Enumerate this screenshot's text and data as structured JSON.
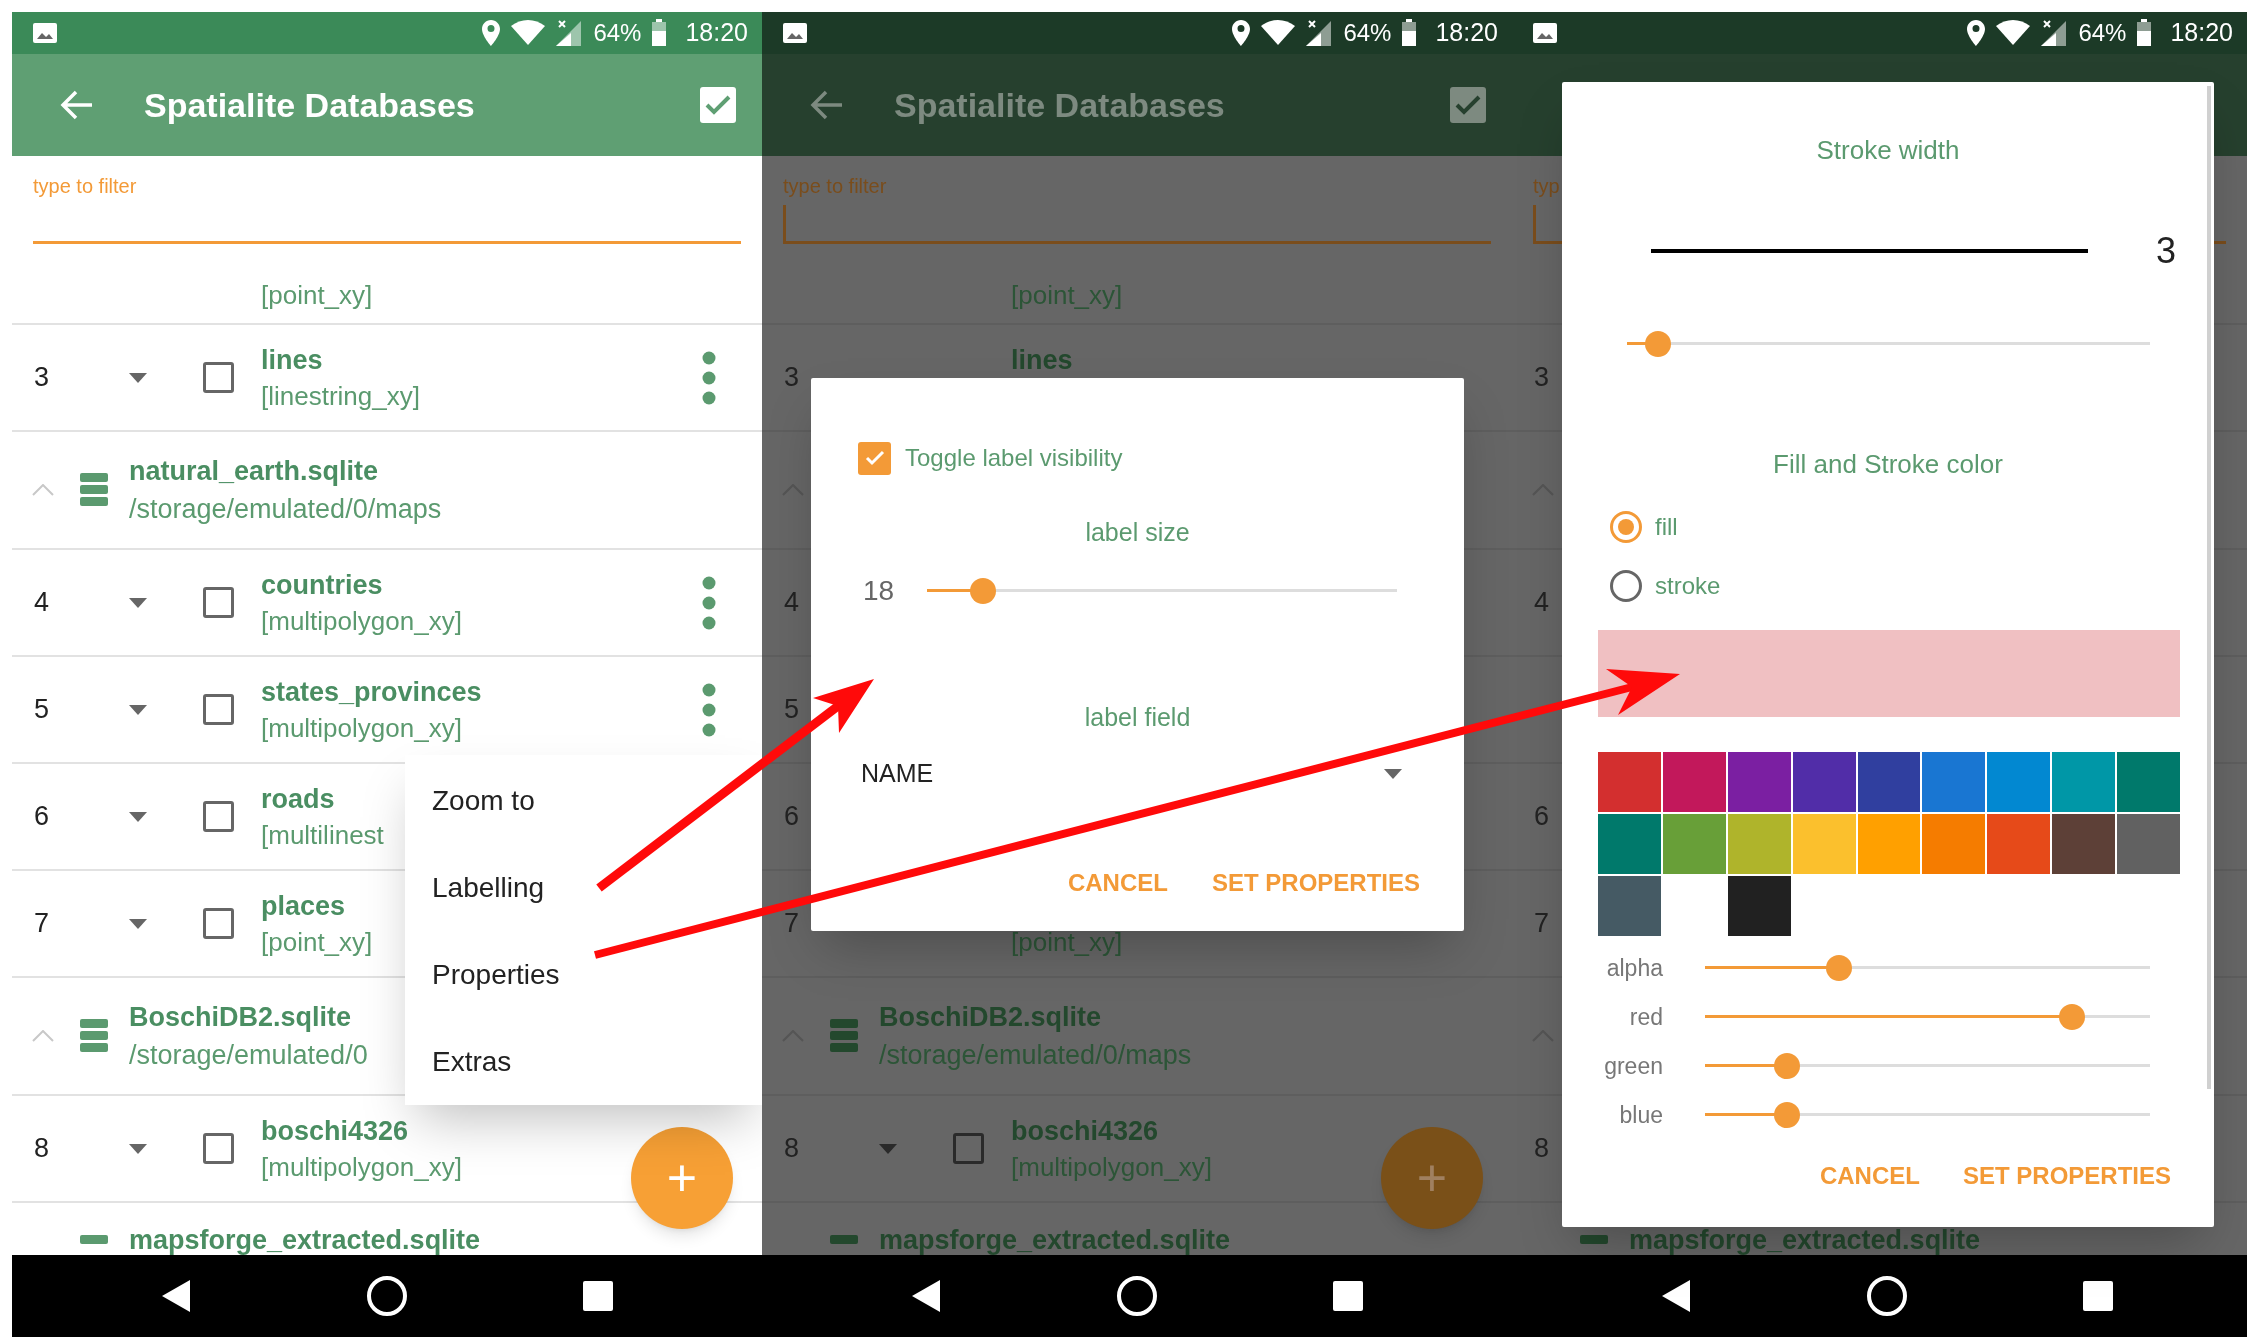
{
  "panels": [
    {
      "dimmed": false,
      "status_bar": {
        "battery": "64%",
        "time": "18:20"
      },
      "toolbar": {
        "title": "Spatialite Databases"
      },
      "filter": {
        "placeholder": "type to filter",
        "focused": false
      },
      "list": [
        {
          "kind": "layer_partial",
          "subtitle": "[point_xy]"
        },
        {
          "kind": "layer",
          "number": "3",
          "caret": true,
          "checked": false,
          "title": "lines",
          "subtitle": "[linestring_xy]",
          "menu": true
        },
        {
          "kind": "database",
          "expanded": true,
          "icon": true,
          "title": "natural_earth.sqlite",
          "path": "/storage/emulated/0/maps"
        },
        {
          "kind": "layer",
          "number": "4",
          "caret": true,
          "checked": false,
          "title": "countries",
          "subtitle": "[multipolygon_xy]",
          "menu": true
        },
        {
          "kind": "layer",
          "number": "5",
          "caret": true,
          "checked": false,
          "title": "states_provinces",
          "subtitle": "[multipolygon_xy]",
          "menu": true
        },
        {
          "kind": "layer",
          "number": "6",
          "caret": true,
          "checked": false,
          "title": "roads",
          "subtitle": "[multilinest"
        },
        {
          "kind": "layer",
          "number": "7",
          "caret": true,
          "checked": false,
          "title": "places",
          "subtitle": "[point_xy]"
        },
        {
          "kind": "database",
          "expanded": true,
          "icon": true,
          "title": "BoschiDB2.sqlite",
          "path": "/storage/emulated/0"
        },
        {
          "kind": "layer",
          "number": "8",
          "caret": true,
          "checked": false,
          "title": "boschi4326",
          "subtitle": "[multipolygon_xy]"
        },
        {
          "kind": "database_partial",
          "icon": true,
          "title": "mapsforge_extracted.sqlite"
        }
      ],
      "menu": {
        "items": [
          "Zoom to",
          "Labelling",
          "Properties",
          "Extras"
        ]
      },
      "fab": {
        "label": "+"
      }
    },
    {
      "dimmed": true,
      "status_bar": {
        "battery": "64%",
        "time": "18:20"
      },
      "toolbar": {
        "title": "Spatialite Databases"
      },
      "filter": {
        "placeholder": "type to filter",
        "focused": true
      },
      "list": [
        {
          "kind": "layer_partial",
          "subtitle": "[point_xy]"
        },
        {
          "kind": "layer",
          "number": "3",
          "title": "lines"
        },
        {
          "kind": "database",
          "expanded": true
        },
        {
          "kind": "layer",
          "number": "4"
        },
        {
          "kind": "layer",
          "number": "5"
        },
        {
          "kind": "layer",
          "number": "6"
        },
        {
          "kind": "layer",
          "number": "7",
          "subtitle": "[point_xy]"
        },
        {
          "kind": "database",
          "expanded": true,
          "icon": true,
          "title": "BoschiDB2.sqlite",
          "path": "/storage/emulated/0/maps"
        },
        {
          "kind": "layer",
          "number": "8",
          "caret": true,
          "checked": false,
          "title": "boschi4326",
          "subtitle": "[multipolygon_xy]"
        },
        {
          "kind": "database_partial",
          "icon": true,
          "title": "mapsforge_extracted.sqlite"
        }
      ],
      "fab": {
        "label": "+"
      },
      "dialog": {
        "kind": "labelling",
        "checkbox": {
          "label": "Toggle label visibility",
          "checked": true
        },
        "size": {
          "heading": "label size",
          "value": "18",
          "level": 0.12
        },
        "field": {
          "heading": "label field",
          "value": "NAME"
        },
        "buttons": [
          "CANCEL",
          "SET PROPERTIES"
        ]
      }
    },
    {
      "dimmed": true,
      "status_bar": {
        "battery": "64%",
        "time": "18:20"
      },
      "filter": {
        "placeholder": "typ",
        "focused": true
      },
      "list": [
        {
          "kind": "layer_partial"
        },
        {
          "kind": "layer",
          "number": "3"
        },
        {
          "kind": "database",
          "expanded": true
        },
        {
          "kind": "layer",
          "number": "4"
        },
        {
          "kind": "layer"
        },
        {
          "kind": "layer",
          "number": "6"
        },
        {
          "kind": "layer",
          "number": "7"
        },
        {
          "kind": "database",
          "expanded": true
        },
        {
          "kind": "layer",
          "number": "8"
        },
        {
          "kind": "database_partial",
          "icon": true,
          "title": "mapsforge_extracted.sqlite"
        }
      ],
      "dialog": {
        "kind": "properties",
        "stroke": {
          "heading": "Stroke width",
          "value": "3",
          "level": 0.06
        },
        "color": {
          "heading": "Fill and Stroke color",
          "options": [
            {
              "label": "fill",
              "selected": true
            },
            {
              "label": "stroke",
              "selected": false
            }
          ],
          "preview": {
            "color": "#f0c0c2"
          },
          "swatches": [
            {
              "color": "#d32f2f"
            },
            {
              "color": "#c2185b"
            },
            {
              "color": "#7b1fa2"
            },
            {
              "color": "#512da8"
            },
            {
              "color": "#303f9f"
            },
            {
              "color": "#1976d2"
            },
            {
              "color": "#0288d1"
            },
            {
              "color": "#0097a7"
            },
            {
              "color": "#00796b"
            },
            {
              "color": "#00796b"
            },
            {
              "color": "#689f38"
            },
            {
              "color": "#afb42b"
            },
            {
              "color": "#fbc02d"
            },
            {
              "color": "#ffa000"
            },
            {
              "color": "#f57c00"
            },
            {
              "color": "#e64a19"
            },
            {
              "color": "#5d4037"
            },
            {
              "color": "#616161"
            },
            {
              "color": "#455a64"
            },
            {
              "kind": "gap"
            },
            {
              "color": "#212121"
            }
          ],
          "channels": [
            {
              "label": "alpha",
              "level": 0.3
            },
            {
              "label": "red",
              "level": 0.825
            },
            {
              "label": "green",
              "level": 0.185
            },
            {
              "label": "blue",
              "level": 0.185
            }
          ]
        },
        "buttons": [
          "CANCEL",
          "SET PROPERTIES"
        ]
      }
    }
  ]
}
